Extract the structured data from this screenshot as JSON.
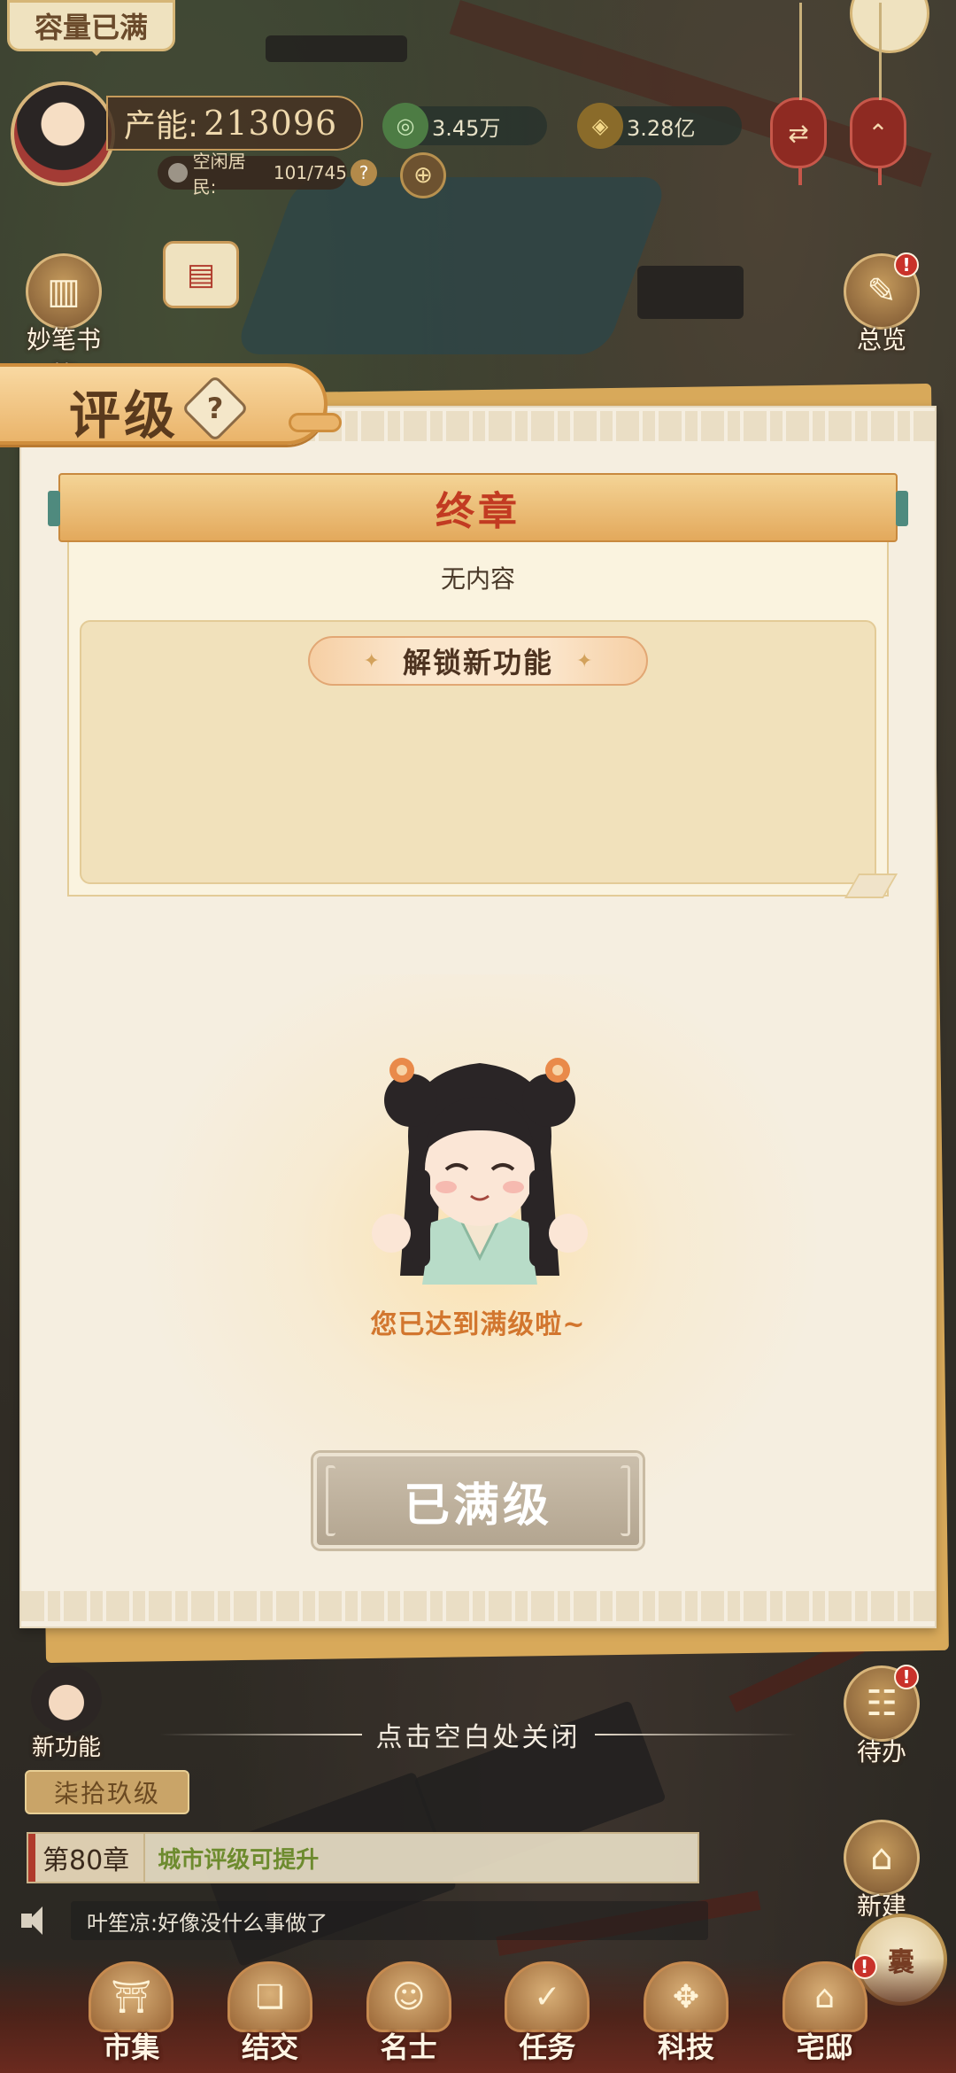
{
  "hud": {
    "capacity_tag": "容量已满",
    "production_label": "产能:",
    "production_value": "213096",
    "idle_residents_label": "空闲居民:",
    "idle_residents_value": "101/745",
    "help_mark": "?",
    "resource_copper": "3.45万",
    "resource_gold": "3.28亿"
  },
  "side_buttons": {
    "notebook": "妙笔书简",
    "overview": "总览",
    "todo": "待办",
    "build": "新建",
    "new_feature": "新功能"
  },
  "rating_panel": {
    "title": "评级",
    "help_mark": "?",
    "stage_title": "终章",
    "content_text": "无内容",
    "unlock_label": "解锁新功能",
    "max_message": "您已达到满级啦~",
    "max_button": "已满级"
  },
  "overlay": {
    "close_hint": "点击空白处关闭"
  },
  "quest": {
    "level_tag": "柒拾玖级",
    "chapter": "第80章",
    "goal": "城市评级可提升"
  },
  "chat": {
    "message": "叶笙凉:好像没什么事做了"
  },
  "bottom_nav": [
    {
      "label": "市集",
      "icon": "market-icon"
    },
    {
      "label": "结交",
      "icon": "befriend-icon"
    },
    {
      "label": "名士",
      "icon": "scholar-icon"
    },
    {
      "label": "任务",
      "icon": "task-icon"
    },
    {
      "label": "科技",
      "icon": "tech-icon"
    },
    {
      "label": "宅邸",
      "icon": "mansion-icon"
    }
  ],
  "colors": {
    "accent_orange": "#d2762e",
    "stage_title_red": "#c23b22",
    "goal_green": "#6d8b2e",
    "badge_red": "#c9322a"
  }
}
